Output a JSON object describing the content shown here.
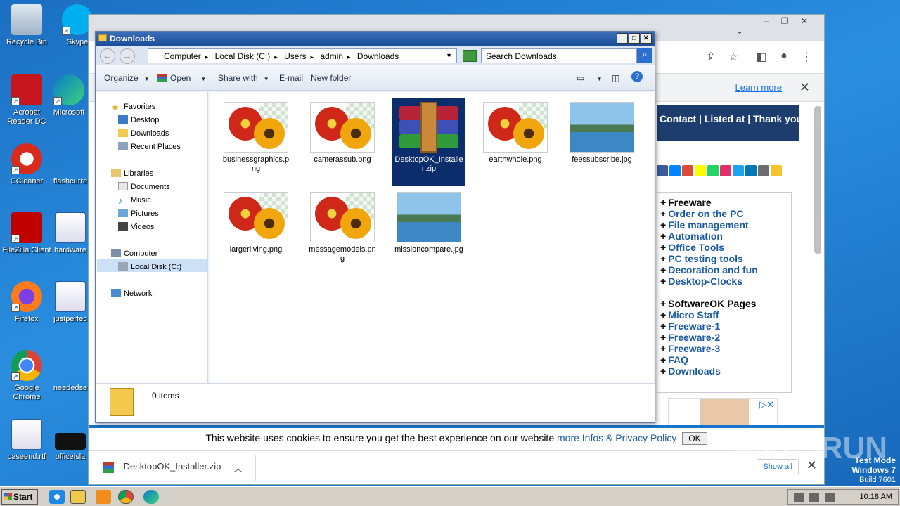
{
  "desktop": {
    "icons": [
      {
        "label": "Recycle Bin"
      },
      {
        "label": "Skype"
      },
      {
        "label": "Acrobat Reader DC"
      },
      {
        "label": "Microsoft"
      },
      {
        "label": "CCleaner"
      },
      {
        "label": "flashcurre"
      },
      {
        "label": "FileZilla Client"
      },
      {
        "label": "hardware"
      },
      {
        "label": "Firefox"
      },
      {
        "label": "justperfec"
      },
      {
        "label": "Google Chrome"
      },
      {
        "label": "neededse"
      },
      {
        "label": "caseend.rtf"
      },
      {
        "label": "officeisla"
      }
    ]
  },
  "browser": {
    "infobar": {
      "learn_more": "Learn more"
    },
    "site_nav": "Contact | Listed at | Thank you",
    "menu": [
      {
        "label": "Freeware",
        "head": true
      },
      {
        "label": "Order on the PC"
      },
      {
        "label": "File management"
      },
      {
        "label": "Automation"
      },
      {
        "label": "Office Tools"
      },
      {
        "label": "PC testing tools"
      },
      {
        "label": "Decoration and fun"
      },
      {
        "label": "Desktop-Clocks"
      },
      {
        "label": "",
        "spacer": true
      },
      {
        "label": "SoftwareOK Pages",
        "head": true
      },
      {
        "label": "Micro Staff"
      },
      {
        "label": "Freeware-1"
      },
      {
        "label": "Freeware-2"
      },
      {
        "label": "Freeware-3"
      },
      {
        "label": "FAQ"
      },
      {
        "label": "Downloads"
      }
    ],
    "social_colors": [
      "#3b5998",
      "#0084ff",
      "#dd4b39",
      "#fffc00",
      "#25d366",
      "#e1306c",
      "#1da1f2",
      "#0077b5",
      "#6d6d6d",
      "#f5c32b"
    ],
    "cookie": {
      "text": "This website uses cookies to ensure you get the best experience on our website",
      "link": "more Infos & Privacy Policy",
      "ok": "OK"
    },
    "download_bar": {
      "file": "DesktopOK_Installer.zip",
      "show_all": "Show all"
    }
  },
  "explorer": {
    "title": "Downloads",
    "breadcrumb": [
      "Computer",
      "Local Disk (C:)",
      "Users",
      "admin",
      "Downloads"
    ],
    "search_placeholder": "Search Downloads",
    "toolbar": {
      "organize": "Organize",
      "open": "Open",
      "share_with": "Share with",
      "email": "E-mail",
      "new_folder": "New folder"
    },
    "nav": {
      "favorites": "Favorites",
      "desktop": "Desktop",
      "downloads": "Downloads",
      "recent": "Recent Places",
      "libraries": "Libraries",
      "documents": "Documents",
      "music": "Music",
      "pictures": "Pictures",
      "videos": "Videos",
      "computer": "Computer",
      "local_disk": "Local Disk (C:)",
      "network": "Network"
    },
    "files": [
      {
        "name": "businessgraphics.png",
        "kind": "flower"
      },
      {
        "name": "camerassub.png",
        "kind": "flower"
      },
      {
        "name": "DesktopOK_Installer.zip",
        "kind": "zip",
        "selected": true
      },
      {
        "name": "earthwhole.png",
        "kind": "flower"
      },
      {
        "name": "feessubscribe.jpg",
        "kind": "landscape"
      },
      {
        "name": "largerliving.png",
        "kind": "flower"
      },
      {
        "name": "messagemodels.png",
        "kind": "flower"
      },
      {
        "name": "missioncompare.jpg",
        "kind": "landscape"
      }
    ],
    "status": "0 items"
  },
  "taskbar": {
    "start": "Start",
    "time": "10:18 AM"
  },
  "watermark": {
    "brand": "ANY RUN",
    "test_mode": "Test Mode",
    "os": "Windows 7",
    "build": "Build 7601"
  }
}
